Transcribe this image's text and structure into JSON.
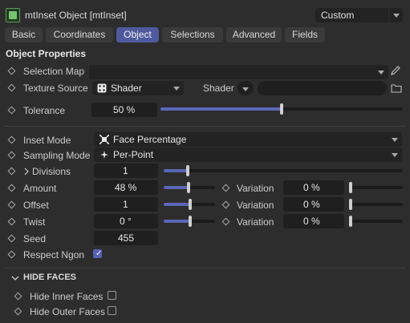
{
  "window": {
    "title": "mtInset Object [mtInset]",
    "preset": "Custom"
  },
  "tabs": [
    "Basic",
    "Coordinates",
    "Object",
    "Selections",
    "Advanced",
    "Fields"
  ],
  "active_tab": "Object",
  "section": {
    "title": "Object Properties"
  },
  "fields": {
    "selection_map": {
      "label": "Selection Map",
      "value": ""
    },
    "texture_source": {
      "label": "Texture Source",
      "value": "Shader"
    },
    "shader": {
      "label": "Shader",
      "value": ""
    },
    "tolerance": {
      "label": "Tolerance",
      "value": "50 %",
      "level": 0.5
    },
    "inset_mode": {
      "label": "Inset Mode",
      "value": "Face Percentage"
    },
    "sampling_mode": {
      "label": "Sampling Mode",
      "value": "Per-Point"
    },
    "divisions": {
      "label": "Divisions",
      "value": "1",
      "level": 0.1
    },
    "amount": {
      "label": "Amount",
      "value": "48 %",
      "level": 0.48,
      "variation_label": "Variation",
      "variation": "0 %"
    },
    "offset": {
      "label": "Offset",
      "value": "1",
      "level": 0.5,
      "variation_label": "Variation",
      "variation": "0 %"
    },
    "twist": {
      "label": "Twist",
      "value": "0 °",
      "level": 0.5,
      "variation_label": "Variation",
      "variation": "0 %"
    },
    "seed": {
      "label": "Seed",
      "value": "455"
    },
    "respect_ngon": {
      "label": "Respect Ngon",
      "checked": true
    }
  },
  "hide_faces": {
    "title": "HIDE FACES",
    "inner": {
      "label": "Hide Inner Faces",
      "checked": false
    },
    "outer": {
      "label": "Hide Outer Faces",
      "checked": false
    }
  },
  "colors": {
    "accent": "#5462b8",
    "background": "#2d2d2d",
    "field": "#1f1f1f"
  }
}
